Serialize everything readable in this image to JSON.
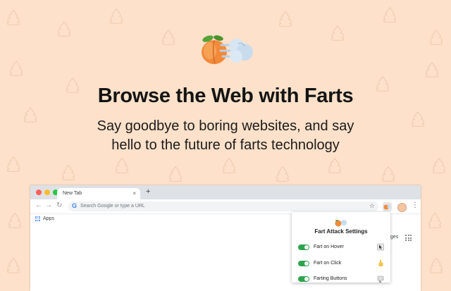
{
  "hero": {
    "headline": "Browse the Web with Farts",
    "subline_1": "Say goodbye to boring websites, and say",
    "subline_2": "hello to the future of farts technology",
    "emoji_icons": [
      "peach-icon",
      "dash-cloud-icon"
    ]
  },
  "colors": {
    "background": "#fde1ca",
    "pattern": "#e9c4a6",
    "toggle_on": "#2ea44f",
    "text_dark": "#141414"
  },
  "browser": {
    "tab_title": "New Tab",
    "tab_close": "×",
    "new_tab": "+",
    "omnibox_placeholder": "Search Google or type a URL",
    "bookmark_apps": "Apps",
    "page_fragment": "ges"
  },
  "popup": {
    "title": "Fart Attack Settings",
    "settings": [
      {
        "label": "Fart on Hover",
        "enabled": true,
        "icon": "cursor-card-icon"
      },
      {
        "label": "Fart on Click",
        "enabled": true,
        "icon": "pointing-hand-icon"
      },
      {
        "label": "Farting Buttons",
        "enabled": true,
        "icon": "button-icon"
      }
    ]
  }
}
